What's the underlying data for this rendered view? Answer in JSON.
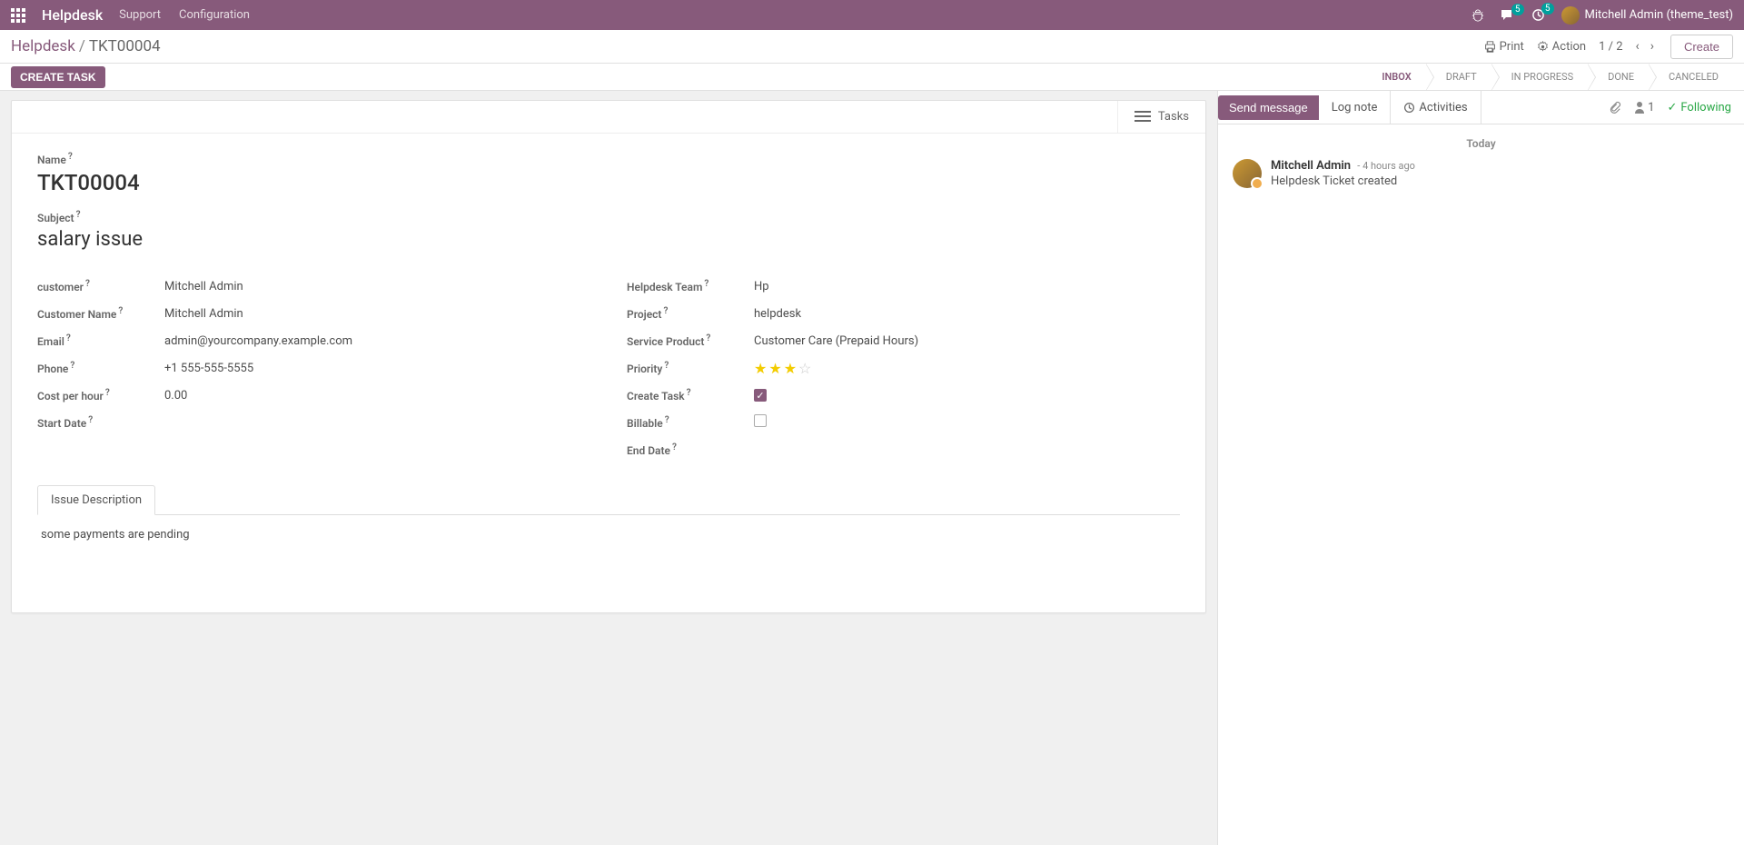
{
  "nav": {
    "brand": "Helpdesk",
    "menu": [
      "Support",
      "Configuration"
    ],
    "chat_badge": "5",
    "clock_badge": "5",
    "user": "Mitchell Admin (theme_test)"
  },
  "breadcrumb": {
    "root": "Helpdesk",
    "current": "TKT00004"
  },
  "controls": {
    "print": "Print",
    "action": "Action",
    "pager": "1 / 2",
    "create": "Create"
  },
  "actions": {
    "create_task": "CREATE TASK"
  },
  "statusbar": [
    "INBOX",
    "DRAFT",
    "IN PROGRESS",
    "DONE",
    "CANCELED"
  ],
  "stat_button": "Tasks",
  "fields": {
    "name_label": "Name",
    "name_value": "TKT00004",
    "subject_label": "Subject",
    "subject_value": "salary issue",
    "left": {
      "customer": {
        "label": "customer",
        "value": "Mitchell Admin"
      },
      "customer_name": {
        "label": "Customer Name",
        "value": "Mitchell Admin"
      },
      "email": {
        "label": "Email",
        "value": "admin@yourcompany.example.com"
      },
      "phone": {
        "label": "Phone",
        "value": "+1 555-555-5555"
      },
      "cost": {
        "label": "Cost per hour",
        "value": "0.00"
      },
      "start": {
        "label": "Start Date",
        "value": ""
      }
    },
    "right": {
      "team": {
        "label": "Helpdesk Team",
        "value": "Hp"
      },
      "project": {
        "label": "Project",
        "value": "helpdesk"
      },
      "service": {
        "label": "Service Product",
        "value": "Customer Care (Prepaid Hours)"
      },
      "priority": {
        "label": "Priority",
        "stars": 3,
        "max": 4
      },
      "create_task": {
        "label": "Create Task",
        "checked": true
      },
      "billable": {
        "label": "Billable",
        "checked": false
      },
      "end": {
        "label": "End Date",
        "value": ""
      }
    }
  },
  "tabs": {
    "issue_desc": {
      "label": "Issue Description",
      "content": "some payments are pending"
    }
  },
  "chatter": {
    "send": "Send message",
    "log": "Log note",
    "activities": "Activities",
    "follower_count": "1",
    "following": "Following",
    "date": "Today",
    "msg": {
      "author": "Mitchell Admin",
      "time": "- 4 hours ago",
      "text": "Helpdesk Ticket created"
    }
  }
}
